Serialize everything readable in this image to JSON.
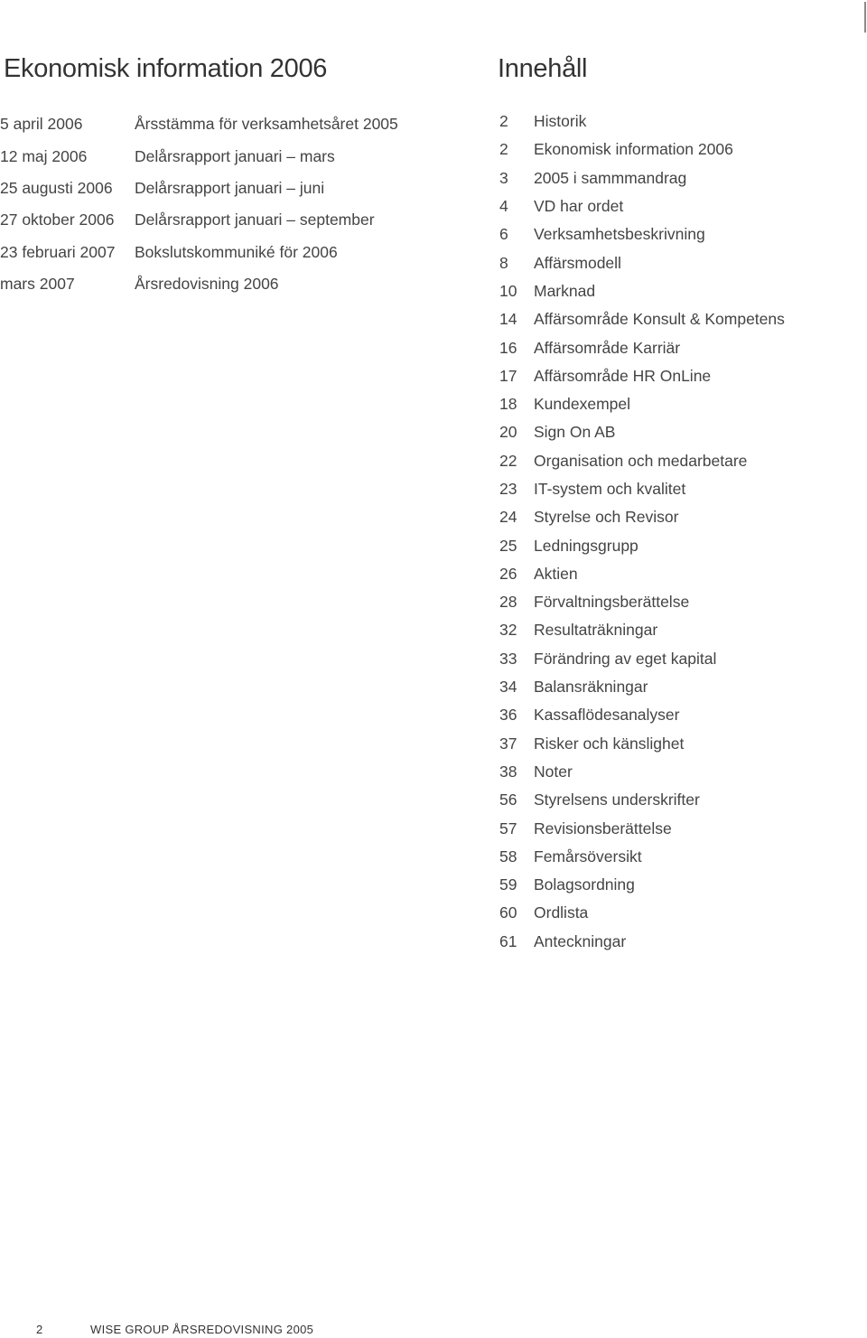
{
  "left": {
    "title": "Ekonomisk information 2006",
    "events": [
      {
        "date": "5 april 2006",
        "description": "Årsstämma för verksamhetsåret 2005"
      },
      {
        "date": "12 maj 2006",
        "description": "Delårsrapport januari – mars"
      },
      {
        "date": "25 augusti 2006",
        "description": "Delårsrapport januari – juni"
      },
      {
        "date": "27 oktober 2006",
        "description": "Delårsrapport januari – september"
      },
      {
        "date": "23 februari 2007",
        "description": "Bokslutskommuniké för 2006"
      },
      {
        "date": "mars 2007",
        "description": "Årsredovisning 2006"
      }
    ]
  },
  "right": {
    "title": "Innehåll",
    "toc": [
      {
        "page": "2",
        "label": "Historik"
      },
      {
        "page": "2",
        "label": "Ekonomisk information 2006"
      },
      {
        "page": "3",
        "label": "2005 i sammmandrag"
      },
      {
        "page": "4",
        "label": "VD har ordet"
      },
      {
        "page": "6",
        "label": "Verksamhetsbeskrivning"
      },
      {
        "page": "8",
        "label": "Affärsmodell"
      },
      {
        "page": "10",
        "label": "Marknad"
      },
      {
        "page": "14",
        "label": "Affärsområde Konsult & Kompetens"
      },
      {
        "page": "16",
        "label": "Affärsområde Karriär"
      },
      {
        "page": "17",
        "label": "Affärsområde HR OnLine"
      },
      {
        "page": "18",
        "label": "Kundexempel"
      },
      {
        "page": "20",
        "label": "Sign On AB"
      },
      {
        "page": "22",
        "label": "Organisation och medarbetare"
      },
      {
        "page": "23",
        "label": "IT-system och kvalitet"
      },
      {
        "page": "24",
        "label": "Styrelse och Revisor"
      },
      {
        "page": "25",
        "label": "Ledningsgrupp"
      },
      {
        "page": "26",
        "label": "Aktien"
      },
      {
        "page": "28",
        "label": "Förvaltningsberättelse"
      },
      {
        "page": "32",
        "label": "Resultaträkningar"
      },
      {
        "page": "33",
        "label": "Förändring av eget kapital"
      },
      {
        "page": "34",
        "label": "Balansräkningar"
      },
      {
        "page": "36",
        "label": "Kassaflödesanalyser"
      },
      {
        "page": "37",
        "label": "Risker och känslighet"
      },
      {
        "page": "38",
        "label": "Noter"
      },
      {
        "page": "56",
        "label": "Styrelsens underskrifter"
      },
      {
        "page": "57",
        "label": "Revisionsberättelse"
      },
      {
        "page": "58",
        "label": "Femårsöversikt"
      },
      {
        "page": "59",
        "label": "Bolagsordning"
      },
      {
        "page": "60",
        "label": "Ordlista"
      },
      {
        "page": "61",
        "label": "Anteckningar"
      }
    ]
  },
  "footer": {
    "page_number": "2",
    "text": "WISE GROUP ÅRSREDOVISNING 2005"
  }
}
